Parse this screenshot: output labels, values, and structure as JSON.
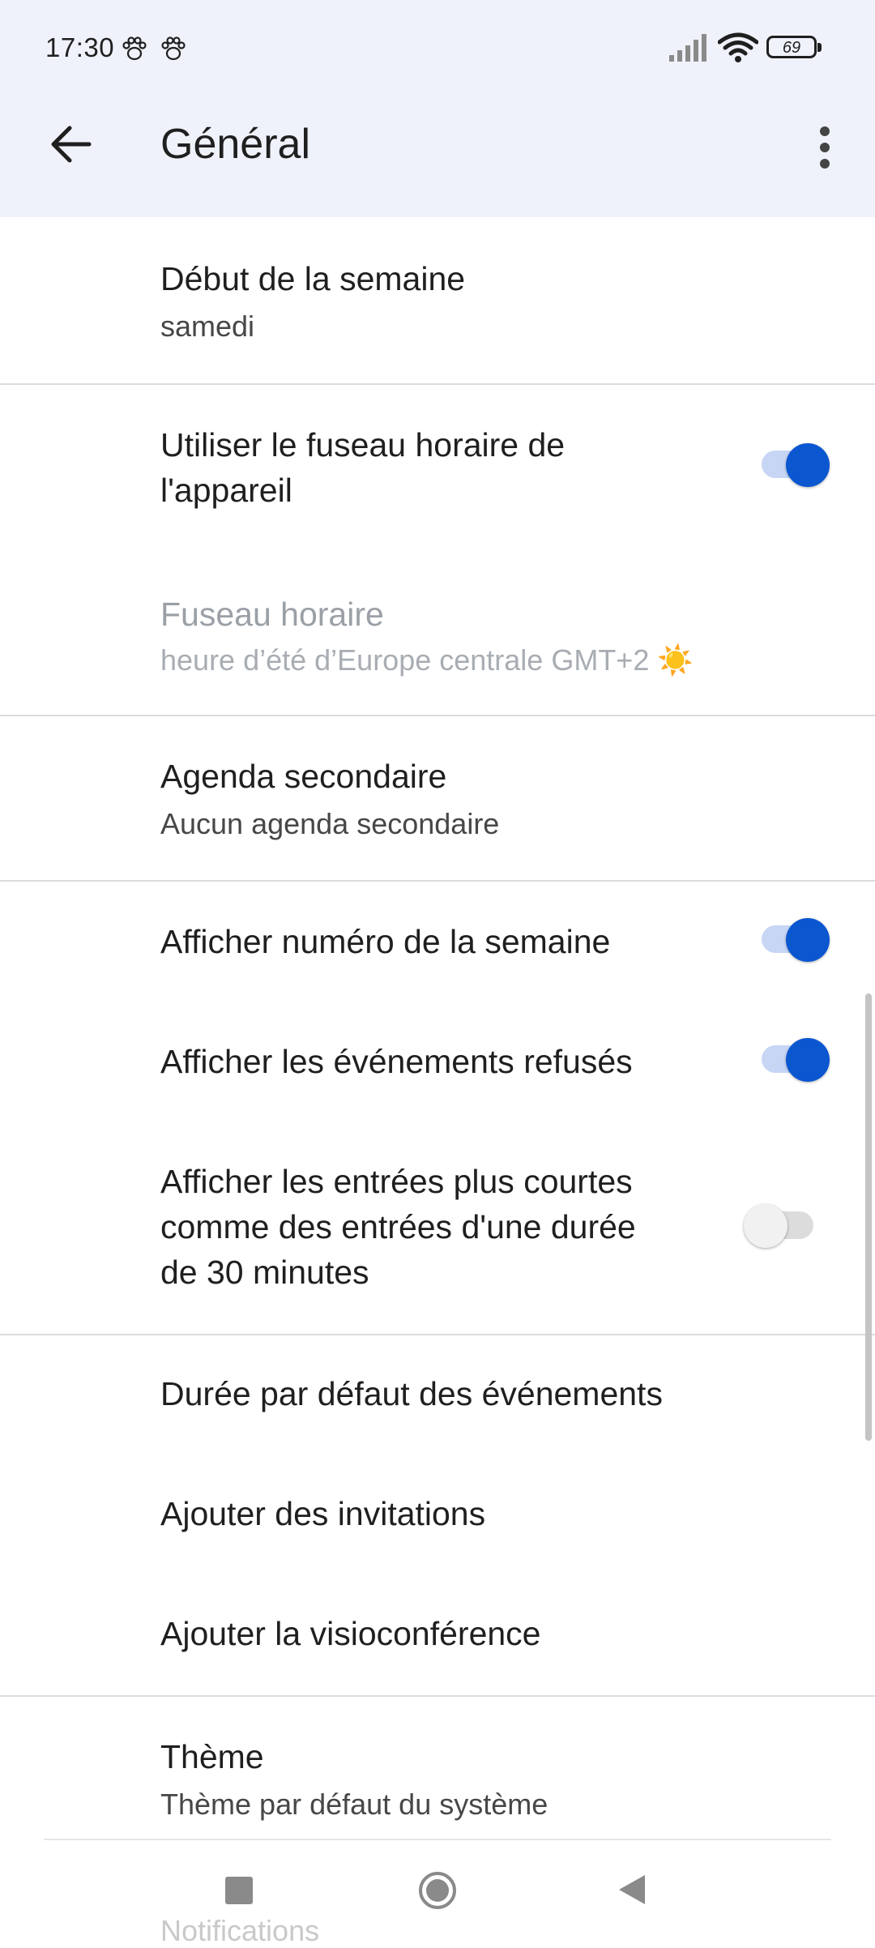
{
  "status_bar": {
    "time": "17:30",
    "battery": "69",
    "icons": [
      "paw-icon",
      "paw-icon",
      "signal-icon",
      "wifi-icon",
      "battery-icon"
    ]
  },
  "toolbar": {
    "title": "Général",
    "back_icon": "arrow-left-icon",
    "more_icon": "more-vert-icon"
  },
  "settings": {
    "week_start": {
      "label": "Début de la semaine",
      "value": "samedi"
    },
    "device_timezone": {
      "label_line1": "Utiliser le fuseau horaire de",
      "label_line2": "l'appareil",
      "enabled": true
    },
    "timezone": {
      "label": "Fuseau horaire",
      "value": "heure d’été d’Europe centrale  GMT+2 ☀️",
      "disabled": true
    },
    "secondary_calendar": {
      "label": "Agenda secondaire",
      "value": "Aucun agenda secondaire"
    },
    "week_number": {
      "label": "Afficher numéro de la semaine",
      "enabled": true
    },
    "declined_events": {
      "label": "Afficher les événements refusés",
      "enabled": true
    },
    "short_entries": {
      "label_line1": "Afficher les entrées plus courtes",
      "label_line2": "comme des entrées d'une durée",
      "label_line3": "de 30 minutes",
      "enabled": false
    },
    "default_duration": {
      "label": "Durée par défaut des événements"
    },
    "add_invitations": {
      "label": "Ajouter des invitations"
    },
    "add_videoconference": {
      "label": "Ajouter la visioconférence"
    },
    "theme": {
      "label": "Thème",
      "value": "Thème par défaut du système"
    },
    "notifications": {
      "label": "Notifications"
    }
  },
  "colors": {
    "accent": "#0b57d0",
    "header_bg": "#eff2fa"
  },
  "nav_bar": {
    "icons": [
      "recents-square-icon",
      "home-circle-icon",
      "back-triangle-icon"
    ]
  }
}
